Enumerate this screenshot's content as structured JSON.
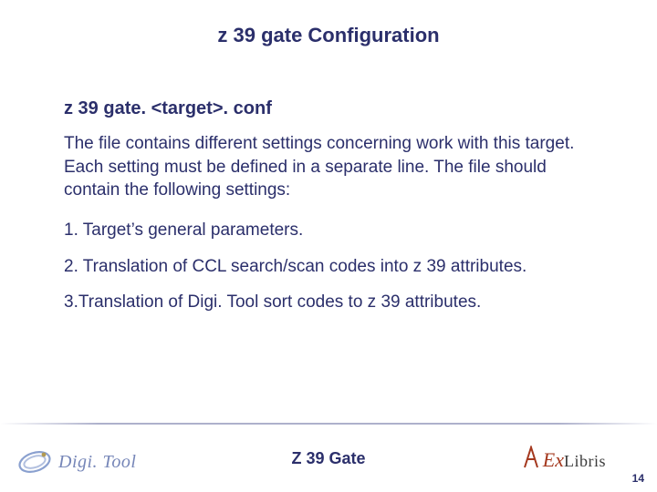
{
  "title": "z 39 gate Configuration",
  "subhead": "z 39 gate. <target>. conf",
  "paragraph": "The file contains different settings concerning work with this target.  Each setting must be defined in a separate line. The file should contain the following settings:",
  "items": [
    "1. Target’s general parameters.",
    "2. Translation of CCL search/scan codes into z 39 attributes.",
    "3.Translation of Digi. Tool sort codes to z 39 attributes."
  ],
  "footer_title": "Z 39 Gate",
  "logo_left": "Digi. Tool",
  "logo_right_prefix": "Ex",
  "logo_right_rest": "Libris",
  "page_number": "14"
}
